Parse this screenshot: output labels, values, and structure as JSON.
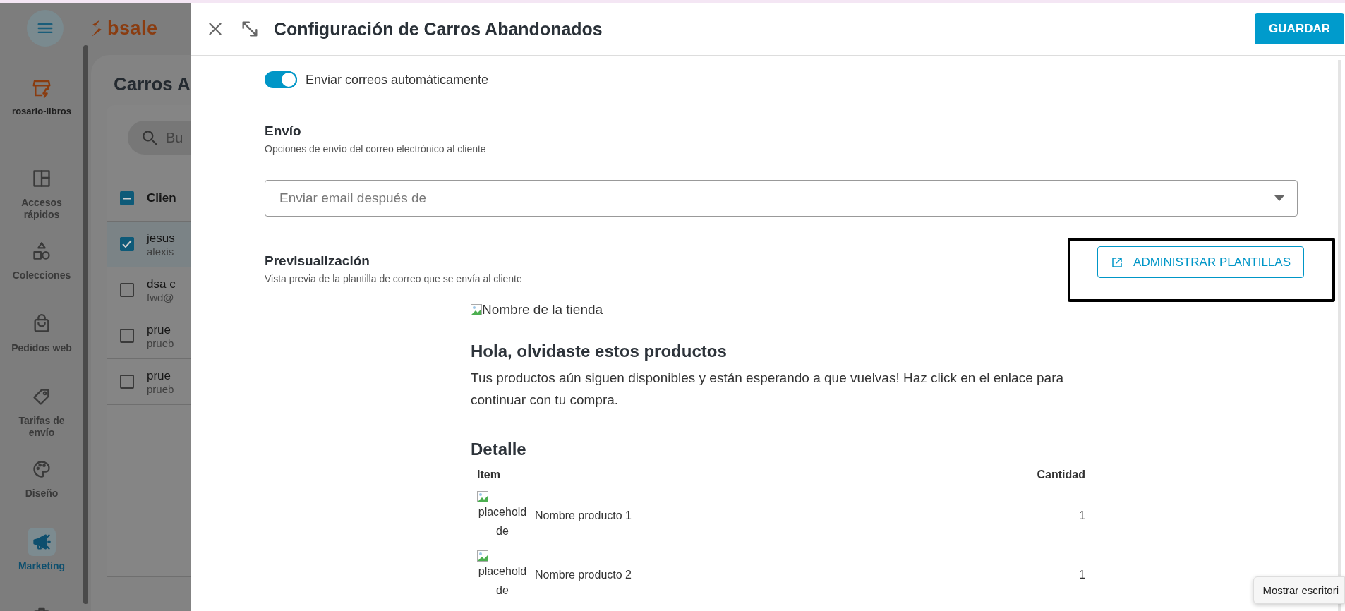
{
  "sidebar": {
    "logo": "bsale",
    "store": "rosario-libros",
    "items": [
      {
        "kind": "layout",
        "label": "Accesos rápidos",
        "selected": false
      },
      {
        "kind": "shapes",
        "label": "Colecciones",
        "selected": false
      },
      {
        "kind": "bag",
        "label": "Pedidos web",
        "selected": false
      },
      {
        "kind": "tag",
        "label": "Tarifas de envío",
        "selected": false
      },
      {
        "kind": "palette",
        "label": "Diseño",
        "selected": false
      },
      {
        "kind": "megaphone",
        "label": "Marketing",
        "selected": true
      },
      {
        "kind": "briefcase",
        "selected": false
      }
    ]
  },
  "background_page": {
    "title": "Carros A",
    "search_placeholder": "Bu",
    "select_all_partial": true,
    "column_1": "Clien",
    "rows": [
      {
        "name": "jesus",
        "email": "alexis",
        "selected": true
      },
      {
        "name": "dsa c",
        "email": "fwd@",
        "selected": false
      },
      {
        "name": "prue",
        "email": "prueb",
        "selected": false
      },
      {
        "name": "prue",
        "email": "prueb",
        "selected": false
      }
    ]
  },
  "drawer": {
    "title": "Configuración de Carros Abandonados",
    "save_button": "GUARDAR",
    "auto_send": {
      "label": "Enviar correos automáticamente",
      "on": true
    },
    "envio": {
      "heading": "Envío",
      "subtitle": "Opciones de envío del correo electrónico al cliente"
    },
    "delay_select": {
      "placeholder": "Enviar email después de"
    },
    "preview": {
      "heading": "Previsualización",
      "subtitle": "Vista previa de la plantilla de correo que se envía al cliente"
    },
    "manage_button": {
      "label": "ADMINISTRAR PLANTILLAS",
      "highlighted": true
    },
    "email": {
      "logo_alt": "Nombre de la tienda",
      "heading": "Hola, olvidaste estos productos",
      "body": "Tus productos aún siguen disponibles y están esperando a que vuelvas! Haz click en el enlace para continuar con tu compra.",
      "detail_heading": "Detalle",
      "columns": [
        "Item",
        "Cantidad"
      ],
      "items": [
        {
          "image_alt": "placehold de",
          "name": "Nombre producto 1",
          "quantity": "1"
        },
        {
          "image_alt": "placehold de",
          "name": "Nombre producto 2",
          "quantity": "1"
        }
      ]
    }
  },
  "tooltip": "Mostrar escritori"
}
